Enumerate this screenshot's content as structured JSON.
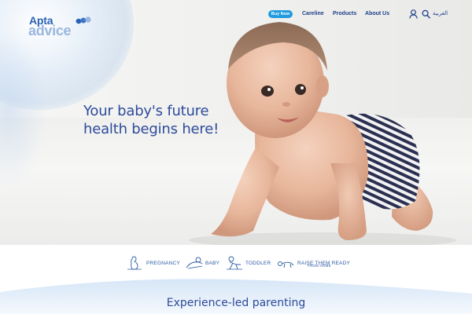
{
  "brand": {
    "line1": "Apta",
    "line2": "advice"
  },
  "nav": {
    "buy_now": "Buy Now",
    "links": [
      "Careline",
      "Products",
      "About Us"
    ],
    "language": "العربية",
    "icons": [
      "user-icon",
      "search-icon"
    ]
  },
  "hero": {
    "headline_line1": "Your baby's future",
    "headline_line2": "health begins here!"
  },
  "categories": {
    "items": [
      {
        "label": "PREGNANCY",
        "icon": "pregnancy-icon"
      },
      {
        "label": "BABY",
        "icon": "baby-icon"
      },
      {
        "label": "TODDLER",
        "icon": "toddler-icon"
      },
      {
        "label": "RAISE THEM READY",
        "sublabel": "FROM HOME",
        "icon": "crawling-baby-icon"
      }
    ]
  },
  "section": {
    "title": "Experience-led parenting"
  },
  "colors": {
    "brand_blue": "#2a62b3",
    "nav_blue": "#1f3f8a",
    "button_blue": "#1f9be0",
    "text_blue": "#2d4b9a",
    "light_blue": "#9ab6df"
  }
}
